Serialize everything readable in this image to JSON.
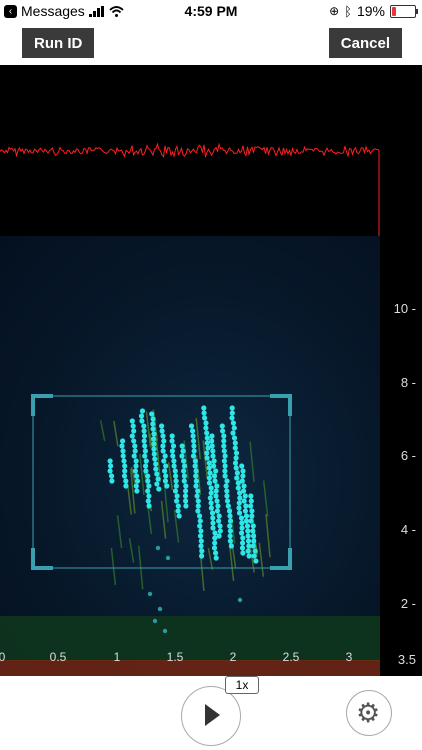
{
  "status_bar": {
    "carrier": "Messages",
    "time": "4:59 PM",
    "battery": "19%",
    "battery_level": 0.19
  },
  "toolbar": {
    "run_label": "Run ID",
    "cancel_label": "Cancel"
  },
  "spectrogram": {
    "freq_ticks": [
      "10 -",
      "8 -",
      "6 -",
      "4 -",
      "2 -",
      "3.5"
    ],
    "time_ticks": [
      "0",
      "0.5",
      "1",
      "1.5",
      "2",
      "2.5",
      "3"
    ]
  },
  "playback": {
    "speed": "1x"
  },
  "colors": {
    "waveform": "#ff2020",
    "detection": "#2ee6e6",
    "selection_border": "#3aa0b0"
  }
}
